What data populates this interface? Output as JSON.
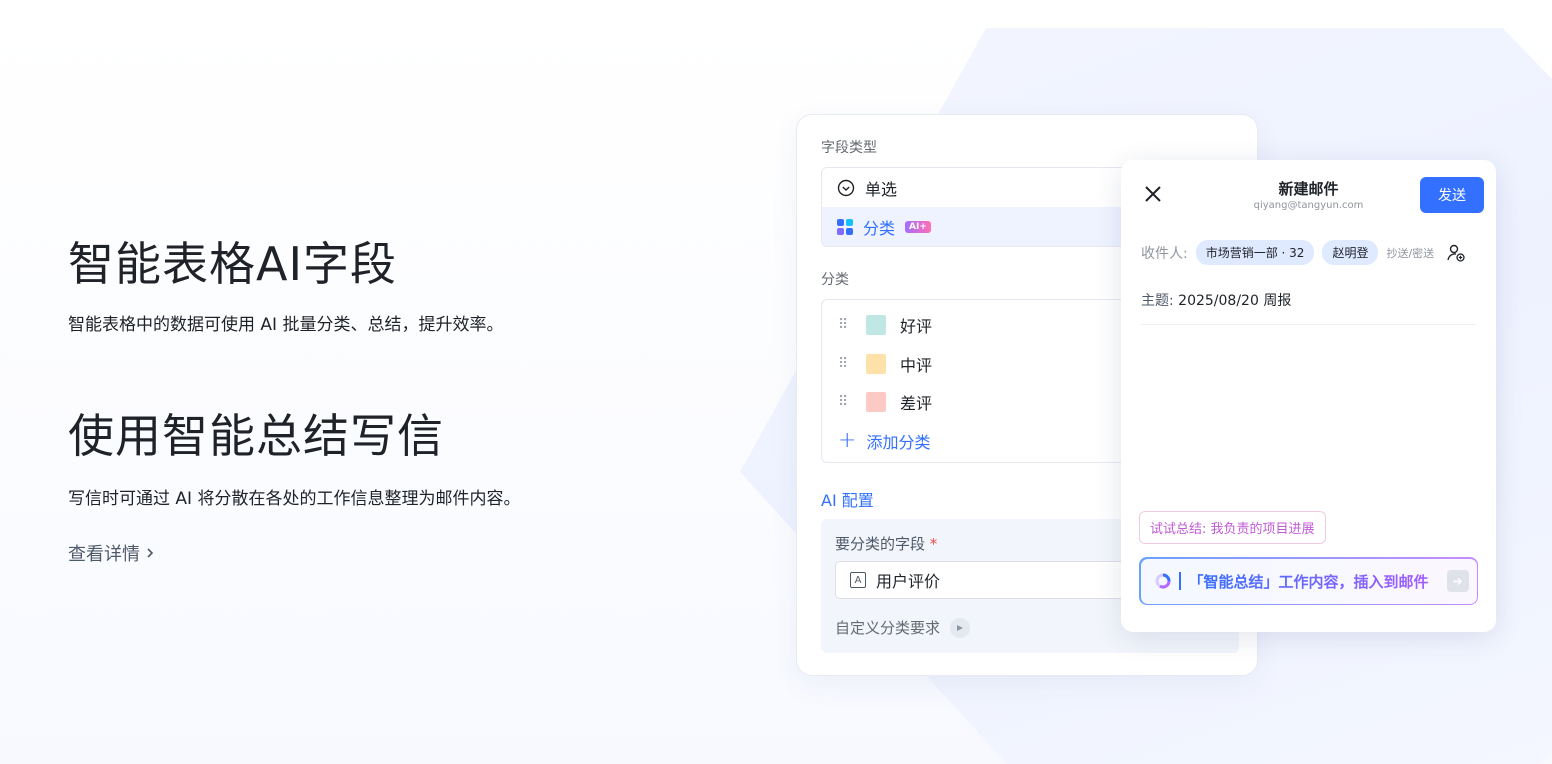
{
  "hero": {
    "title1": "智能表格AI字段",
    "desc1": "智能表格中的数据可使用 AI 批量分类、总结，提升效率。",
    "title2": "使用智能总结写信",
    "desc2": "写信时可通过 AI 将分散在各处的工作信息整理为邮件内容。",
    "more_link": "查看详情"
  },
  "field_card": {
    "field_type_label": "字段类型",
    "types": [
      {
        "label": "单选",
        "icon": "circle-check-icon"
      },
      {
        "label": "分类",
        "icon": "grid-icon",
        "badge": "AI+"
      }
    ],
    "category_label": "分类",
    "categories": [
      {
        "label": "好评",
        "color": "#bfe8e4"
      },
      {
        "label": "中评",
        "color": "#fde1a8"
      },
      {
        "label": "差评",
        "color": "#fdc9c4"
      }
    ],
    "add_category": "添加分类",
    "ai_config_title": "AI 配置",
    "field_to_classify_label": "要分类的字段",
    "required_mark": "*",
    "field_value": "用户评价",
    "custom_requirement": "自定义分类要求"
  },
  "mail_card": {
    "title": "新建邮件",
    "sender": "qiyang@tangyun.com",
    "send_button": "发送",
    "recipients_label": "收件人:",
    "recipients": [
      "市场营销一部 · 32",
      "赵明登"
    ],
    "cc_label": "抄送/密送",
    "subject_label": "主题:",
    "subject_value": "2025/08/20 周报",
    "suggestion": "试试总结: 我负责的项目进展",
    "ai_prompt": "「智能总结」工作内容，插入到邮件"
  },
  "colors": {
    "primary": "#3370ff",
    "grid_icon": [
      "#3370ff",
      "#14c0ff",
      "#7f6bff",
      "#3370ff"
    ]
  }
}
